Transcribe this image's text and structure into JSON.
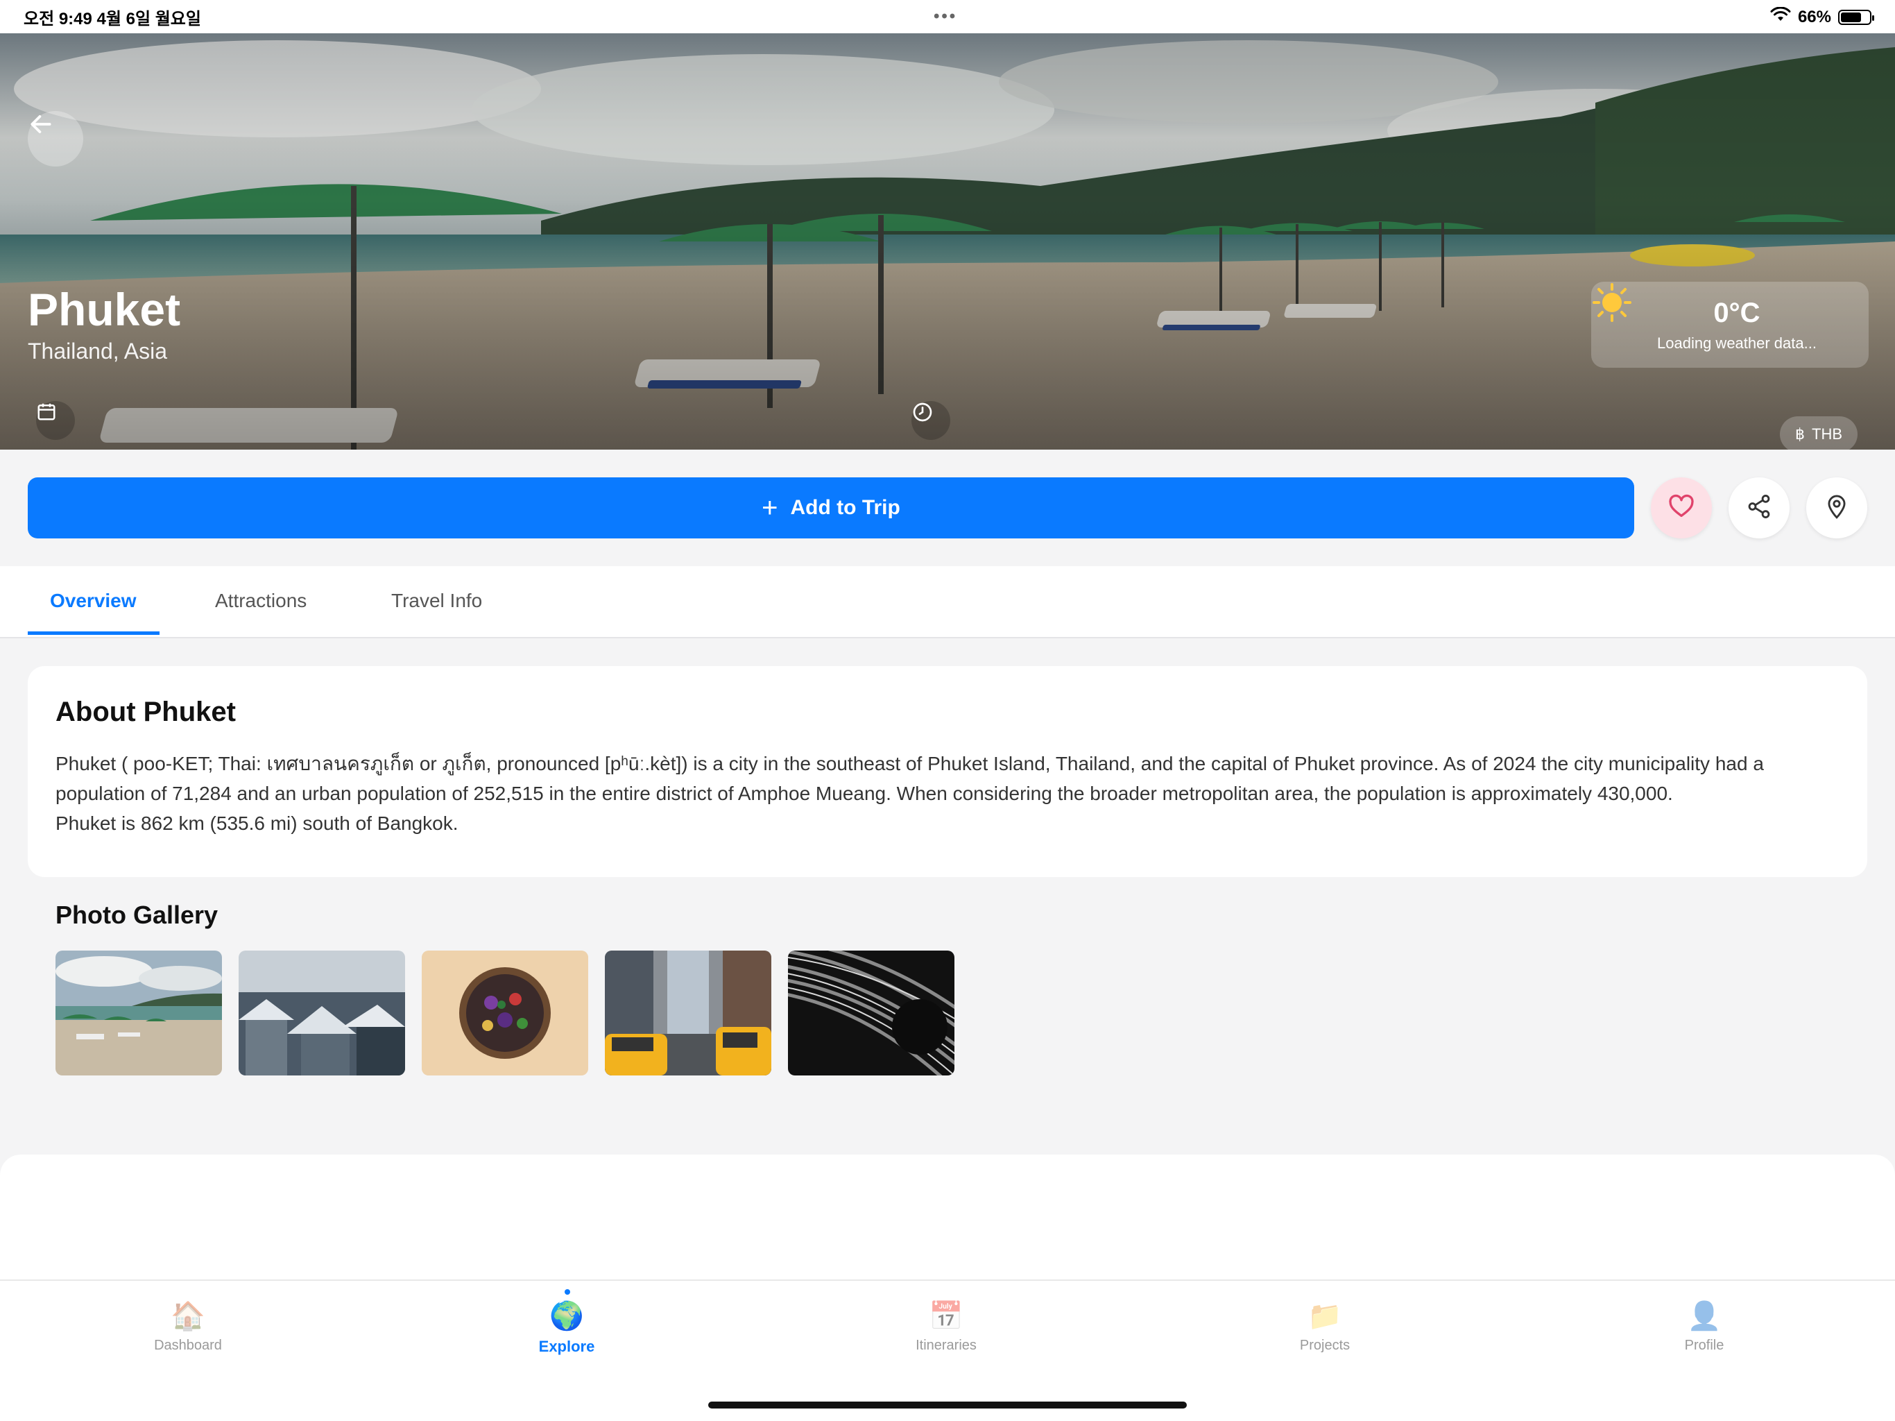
{
  "status_bar": {
    "time": "오전 9:49  4월 6일 월요일",
    "dots": "•••",
    "battery_percent": "66%",
    "battery_level": 0.66
  },
  "hero": {
    "title": "Phuket",
    "subtitle": "Thailand, Asia",
    "weather": {
      "temperature": "0°C",
      "status": "Loading weather data...",
      "icon": "sun-icon"
    },
    "currency": "THB",
    "currency_symbol": "฿"
  },
  "actions": {
    "add_to_trip": "Add to Trip",
    "plus": "+"
  },
  "tabs": [
    "Overview",
    "Attractions",
    "Travel Info"
  ],
  "about": {
    "title": "About Phuket",
    "body_lines": [
      "Phuket ( poo-KET; Thai: เทศบาลนครภูเก็ต or ภูเก็ต, pronounced [pʰūː.kèt]) is a city in the southeast of Phuket Island, Thailand, and the capital of Phuket province. As of 2024 the city municipality had a",
      "population of 71,284 and an urban population of 252,515 in the entire district of Amphoe Mueang. When considering the broader metropolitan area, the population is approximately 430,000.",
      "Phuket is 862 km (535.6 mi) south of Bangkok."
    ]
  },
  "gallery": {
    "title": "Photo Gallery",
    "photos": [
      "beach",
      "snowy-city",
      "food-bowl",
      "city-taxis",
      "abstract-pattern"
    ]
  },
  "tabbar": [
    {
      "label": "Dashboard",
      "icon": "🏠"
    },
    {
      "label": "Explore",
      "icon": "🌍"
    },
    {
      "label": "Itineraries",
      "icon": "📅"
    },
    {
      "label": "Projects",
      "icon": "📁"
    },
    {
      "label": "Profile",
      "icon": "👤"
    }
  ],
  "colors": {
    "accent": "#0a7aff",
    "favorite_bg": "#fde0e6",
    "favorite_icon": "#e0436b"
  }
}
